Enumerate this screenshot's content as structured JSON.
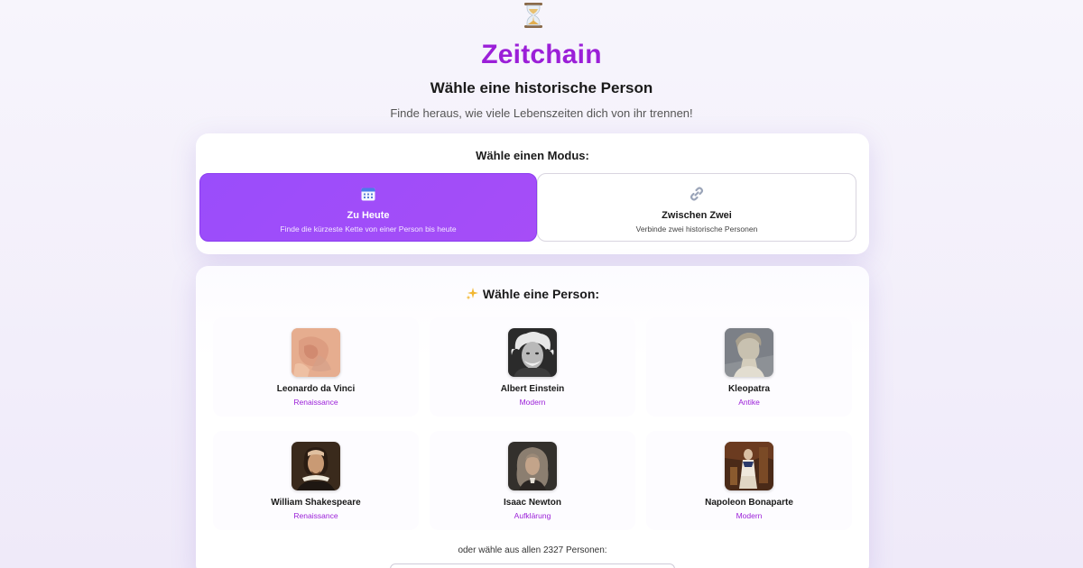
{
  "header": {
    "icon": "hourglass-icon",
    "brand": "Zeitchain",
    "subtitle": "Wähle eine historische Person",
    "tagline": "Finde heraus, wie viele Lebenszeiten dich von ihr trennen!"
  },
  "mode": {
    "heading": "Wähle einen Modus:",
    "options": [
      {
        "icon": "calendar-icon",
        "title": "Zu Heute",
        "description": "Finde die kürzeste Kette von einer Person bis heute",
        "selected": true
      },
      {
        "icon": "link-icon",
        "title": "Zwischen Zwei",
        "description": "Verbinde zwei historische Personen",
        "selected": false
      }
    ]
  },
  "persons": {
    "heading": "Wähle eine Person:",
    "heading_icon": "sparkle-icon",
    "items": [
      {
        "name": "Leonardo da Vinci",
        "era": "Renaissance"
      },
      {
        "name": "Albert Einstein",
        "era": "Modern"
      },
      {
        "name": "Kleopatra",
        "era": "Antike"
      },
      {
        "name": "William Shakespeare",
        "era": "Renaissance"
      },
      {
        "name": "Isaac Newton",
        "era": "Aufklärung"
      },
      {
        "name": "Napoleon Bonaparte",
        "era": "Modern"
      }
    ],
    "all_label": "oder wähle aus allen 2327 Personen:"
  },
  "colors": {
    "brand": "#9b1fd8",
    "active_mode": "#9a4dfb",
    "era_text": "#9b1fd8"
  }
}
